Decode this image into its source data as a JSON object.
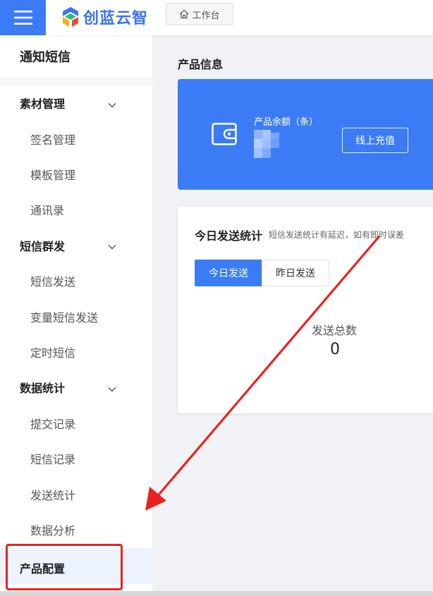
{
  "header": {
    "brand": "创蓝云智",
    "workbench_label": "工作台",
    "accent": "#3b7cf6"
  },
  "sidebar": {
    "title": "通知短信",
    "groups": [
      {
        "label": "素材管理",
        "items": [
          "签名管理",
          "模板管理",
          "通讯录"
        ]
      },
      {
        "label": "短信群发",
        "items": [
          "短信发送",
          "变量短信发送",
          "定时短信"
        ]
      },
      {
        "label": "数据统计",
        "items": [
          "提交记录",
          "短信记录",
          "发送统计",
          "数据分析"
        ]
      }
    ],
    "active_item": "产品配置"
  },
  "main": {
    "product_info_title": "产品信息",
    "balance_label": "产品余额（条）",
    "recharge_button": "线上充值",
    "stats_title": "今日发送统计",
    "stats_note": "短信发送统计有延迟，如有即时误差",
    "tabs": [
      "今日发送",
      "昨日发送"
    ],
    "total_label": "发送总数",
    "total_value": "0"
  },
  "annotation": {
    "color": "#e8231f"
  },
  "icons": [
    "menu-icon",
    "logo-icon",
    "home-icon",
    "chevron-down-icon",
    "wallet-icon"
  ]
}
